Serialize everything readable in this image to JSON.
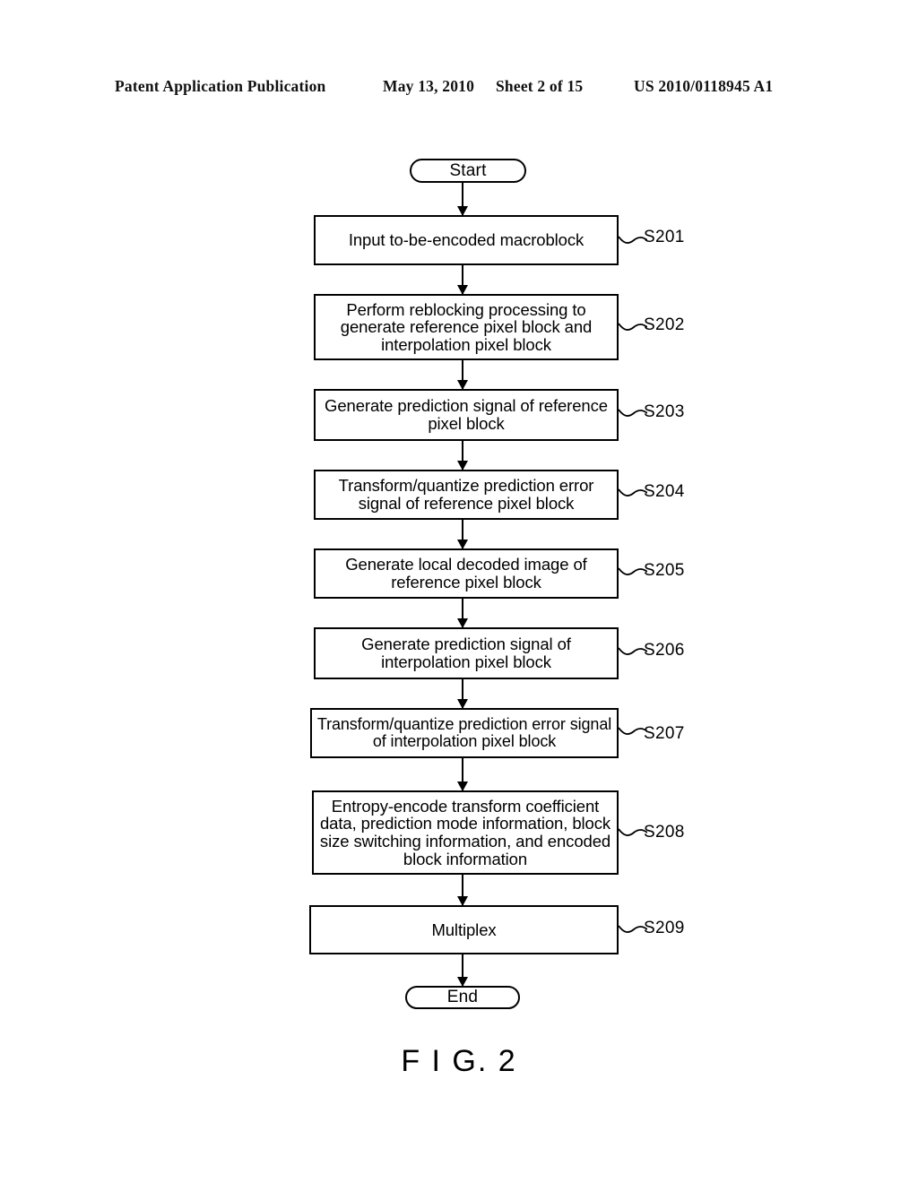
{
  "header": {
    "publication": "Patent Application Publication",
    "date": "May 13, 2010",
    "sheet": "Sheet 2 of 15",
    "number": "US 2010/0118945 A1"
  },
  "figure": {
    "caption": "F I G. 2",
    "start_label": "Start",
    "end_label": "End"
  },
  "flowchart": {
    "type": "flowchart",
    "orientation": "top-to-bottom",
    "nodes": [
      {
        "id": "start",
        "shape": "terminal",
        "text": "Start",
        "step": ""
      },
      {
        "id": "s201",
        "shape": "process",
        "step": "S201",
        "lines": [
          "Input to-be-encoded macroblock"
        ]
      },
      {
        "id": "s202",
        "shape": "process",
        "step": "S202",
        "lines": [
          "Perform reblocking processing to",
          "generate reference pixel block and",
          "interpolation pixel block"
        ]
      },
      {
        "id": "s203",
        "shape": "process",
        "step": "S203",
        "lines": [
          "Generate prediction signal of reference",
          "pixel block"
        ]
      },
      {
        "id": "s204",
        "shape": "process",
        "step": "S204",
        "lines": [
          "Transform/quantize prediction error",
          "signal of reference pixel block"
        ]
      },
      {
        "id": "s205",
        "shape": "process",
        "step": "S205",
        "lines": [
          "Generate local decoded image of",
          "reference pixel block"
        ]
      },
      {
        "id": "s206",
        "shape": "process",
        "step": "S206",
        "lines": [
          "Generate prediction signal of",
          "interpolation pixel block"
        ]
      },
      {
        "id": "s207",
        "shape": "process",
        "step": "S207",
        "lines": [
          "Transform/quantize prediction error signal",
          "of interpolation pixel block"
        ]
      },
      {
        "id": "s208",
        "shape": "process",
        "step": "S208",
        "lines": [
          "Entropy-encode transform coefficient",
          "data, prediction mode information, block",
          "size switching information, and encoded",
          "block information"
        ]
      },
      {
        "id": "s209",
        "shape": "process",
        "step": "S209",
        "lines": [
          "Multiplex"
        ]
      },
      {
        "id": "end",
        "shape": "terminal",
        "text": "End",
        "step": ""
      }
    ],
    "edges": [
      {
        "from": "start",
        "to": "s201"
      },
      {
        "from": "s201",
        "to": "s202"
      },
      {
        "from": "s202",
        "to": "s203"
      },
      {
        "from": "s203",
        "to": "s204"
      },
      {
        "from": "s204",
        "to": "s205"
      },
      {
        "from": "s205",
        "to": "s206"
      },
      {
        "from": "s206",
        "to": "s207"
      },
      {
        "from": "s207",
        "to": "s208"
      },
      {
        "from": "s208",
        "to": "s209"
      },
      {
        "from": "s209",
        "to": "end"
      }
    ]
  },
  "colors": {
    "ink": "#000000",
    "paper": "#ffffff"
  }
}
